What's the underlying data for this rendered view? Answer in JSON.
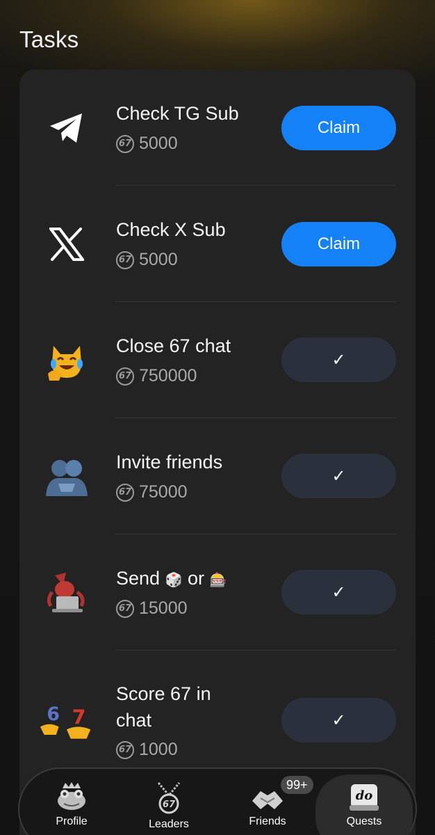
{
  "header": {
    "title": "Tasks"
  },
  "tasks": [
    {
      "name": "Check TG Sub",
      "reward": "5000",
      "button": "Claim",
      "icon": "telegram-icon"
    },
    {
      "name": "Check X Sub",
      "reward": "5000",
      "button": "Claim",
      "icon": "x-logo-icon"
    },
    {
      "name": "Close 67 chat",
      "reward": "750000",
      "button": "✓",
      "icon": "cat-tears-of-joy-icon"
    },
    {
      "name": "Invite friends",
      "reward": "75000",
      "button": "✓",
      "icon": "people-hugging-icon"
    },
    {
      "name_prefix": "Send",
      "name_middle": "or",
      "reward": "15000",
      "button": "✓",
      "icon": "squid-laptop-icon",
      "emoji_dice": "🎲",
      "emoji_slot": "🎰"
    },
    {
      "name_line1": "Score 67 in",
      "name_line2": "chat",
      "reward": "1000",
      "button": "✓",
      "icon": "six-seven-hands-icon"
    }
  ],
  "coin_label": "67",
  "nav": {
    "items": [
      {
        "label": "Profile",
        "icon": "frog-crown-icon"
      },
      {
        "label": "Leaders",
        "icon": "medal-67-icon"
      },
      {
        "label": "Friends",
        "icon": "handshake-icon",
        "badge": "99+"
      },
      {
        "label": "Quests",
        "icon": "do-key-icon"
      }
    ],
    "active": "Quests"
  },
  "colors": {
    "accent": "#1482f6",
    "done_button": "#2a313d",
    "card": "#232323"
  }
}
